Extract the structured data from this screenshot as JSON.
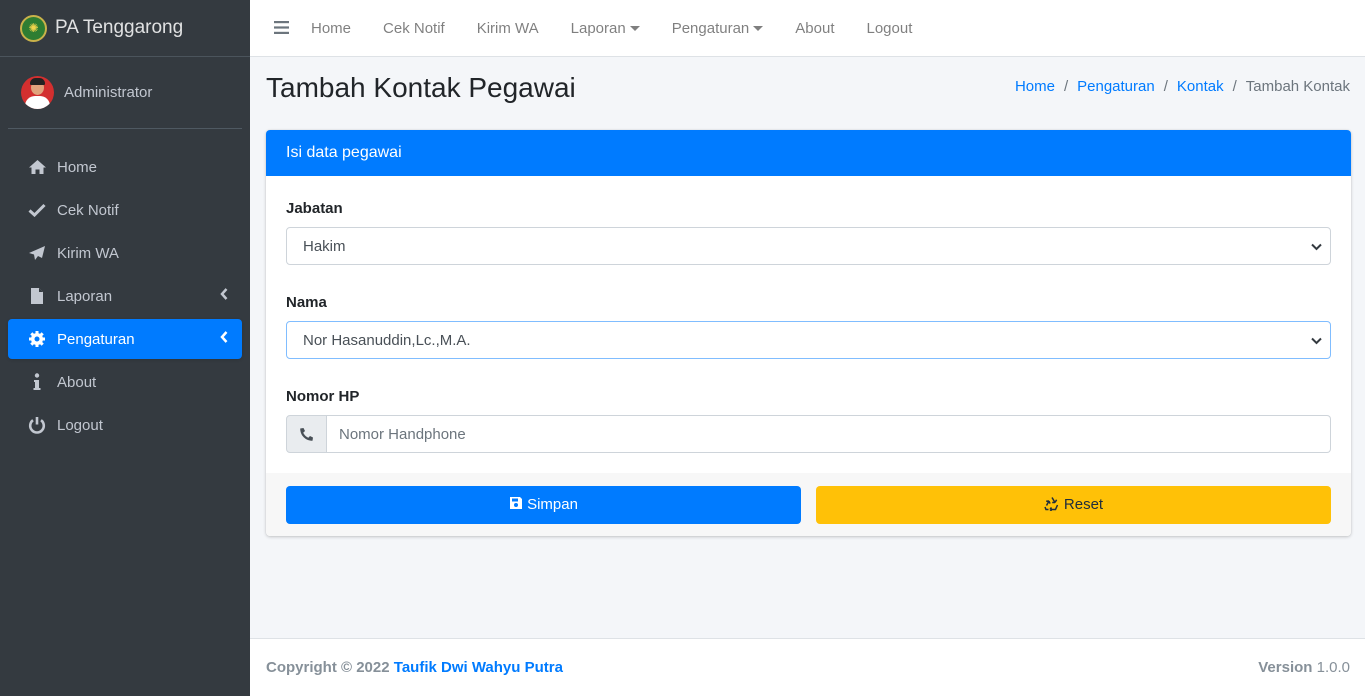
{
  "brand": {
    "name": "PA Tenggarong",
    "logo_icon": "court-emblem-icon"
  },
  "user": {
    "name": "Administrator"
  },
  "sidebar": {
    "items": [
      {
        "label": "Home",
        "icon": "home-icon"
      },
      {
        "label": "Cek Notif",
        "icon": "check-icon"
      },
      {
        "label": "Kirim WA",
        "icon": "paper-plane-icon"
      },
      {
        "label": "Laporan",
        "icon": "file-icon"
      },
      {
        "label": "Pengaturan",
        "icon": "gear-icon"
      },
      {
        "label": "About",
        "icon": "info-icon"
      },
      {
        "label": "Logout",
        "icon": "power-icon"
      }
    ]
  },
  "topnav": {
    "items": [
      "Home",
      "Cek Notif",
      "Kirim WA",
      "Laporan",
      "Pengaturan",
      "About",
      "Logout"
    ]
  },
  "page": {
    "title": "Tambah Kontak Pegawai",
    "breadcrumb": [
      "Home",
      "Pengaturan",
      "Kontak",
      "Tambah Kontak"
    ]
  },
  "form": {
    "header": "Isi data pegawai",
    "jabatan_label": "Jabatan",
    "jabatan_value": "Hakim",
    "nama_label": "Nama",
    "nama_value": "Nor Hasanuddin,Lc.,M.A.",
    "hp_label": "Nomor HP",
    "hp_placeholder": "Nomor Handphone",
    "save_label": "Simpan",
    "reset_label": "Reset"
  },
  "footer": {
    "copyright": "Copyright © 2022",
    "author": "Taufik Dwi Wahyu Putra",
    "version_label": "Version",
    "version": "1.0.0"
  },
  "colors": {
    "primary": "#007bff",
    "warning": "#ffc107",
    "sidebar": "#343a40"
  }
}
